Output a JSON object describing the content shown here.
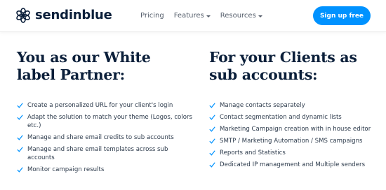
{
  "header": {
    "logo_text": "sendinblue",
    "nav": [
      {
        "label": "Pricing",
        "has_dropdown": false
      },
      {
        "label": "Features",
        "has_dropdown": true
      },
      {
        "label": "Resources",
        "has_dropdown": true
      }
    ],
    "cta_label": "Sign up free"
  },
  "left": {
    "heading_line1": "You as our White",
    "heading_line2": "label Partner:",
    "items": [
      "Create a personalized URL for your client's login",
      "Adapt the solution to match your theme (Logos, colors etc.)",
      "Manage and share email credits to sub accounts",
      "Manage and share email templates across sub accounts",
      "Monitor campaign results"
    ]
  },
  "right": {
    "heading_line1": "For your Clients as",
    "heading_line2": "sub accounts:",
    "items": [
      "Manage contacts separately",
      "Contact segmentation and dynamic lists",
      "Marketing Campaign creation with in house editor",
      "SMTP / Marketing Automation / SMS campaigns",
      "Reports and Statistics",
      "Dedicated IP management and Multiple senders"
    ]
  },
  "colors": {
    "brand_navy": "#0b1f3a",
    "cta_blue": "#0092ff",
    "check_blue": "#0092ff"
  },
  "icons": {
    "logo": "sendinblue-logo-icon",
    "check": "checkmark-icon",
    "caret": "caret-down-icon"
  }
}
